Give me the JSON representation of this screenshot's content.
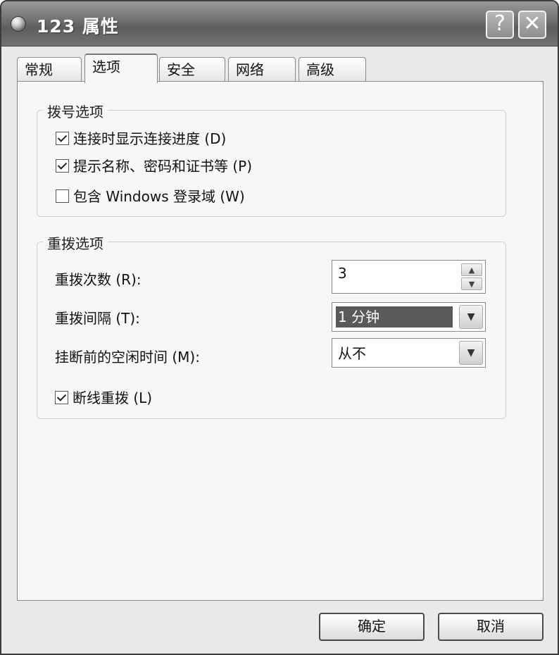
{
  "window": {
    "title": "123 属性"
  },
  "titlebar_buttons": {
    "help": "?",
    "close": "✕"
  },
  "tabs": [
    {
      "label": "常规",
      "selected": false
    },
    {
      "label": "选项",
      "selected": true
    },
    {
      "label": "安全",
      "selected": false
    },
    {
      "label": "网络",
      "selected": false
    },
    {
      "label": "高级",
      "selected": false
    }
  ],
  "dial_options": {
    "title": "拨号选项",
    "items": [
      {
        "label": "连接时显示连接进度 (D)",
        "checked": true
      },
      {
        "label": "提示名称、密码和证书等 (P)",
        "checked": true
      },
      {
        "label": "包含 Windows 登录域 (W)",
        "checked": false
      }
    ]
  },
  "redial_options": {
    "title": "重拨选项",
    "attempts_label": "重拨次数 (R):",
    "attempts_value": "3",
    "interval_label": "重拨间隔 (T):",
    "interval_value": "1 分钟",
    "idle_label": "挂断前的空闲时间 (M):",
    "idle_value": "从不",
    "redial_on_drop_label": "断线重拨 (L)",
    "redial_on_drop_checked": true
  },
  "buttons": {
    "ok": "确定",
    "cancel": "取消"
  },
  "icons": {
    "spin_up": "up-arrow-icon",
    "spin_down": "down-arrow-icon",
    "dropdown": "chevron-down-icon"
  }
}
